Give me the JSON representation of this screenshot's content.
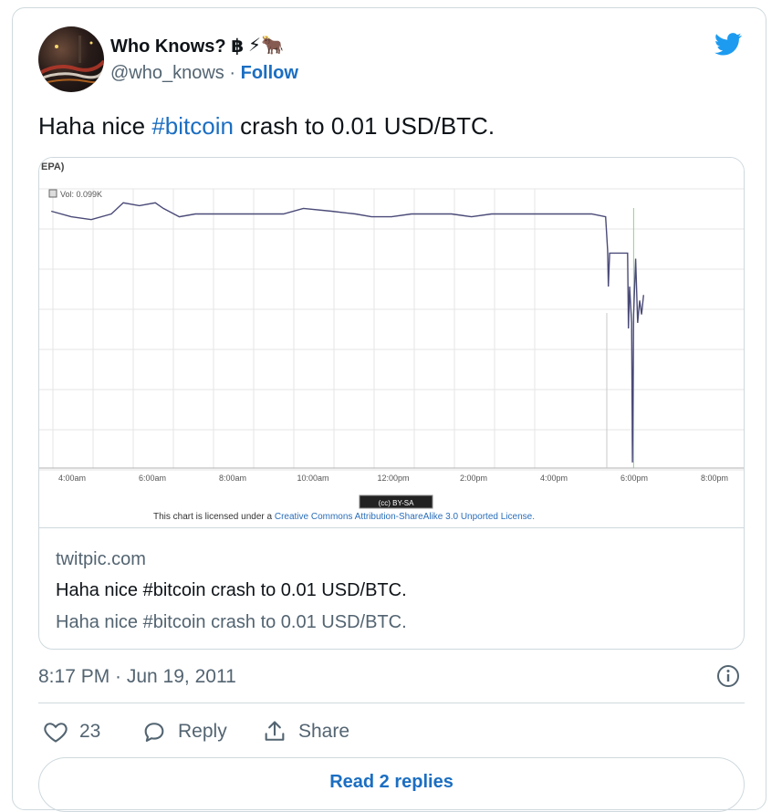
{
  "tweet": {
    "author_name": "Who Knows? ฿",
    "author_emoji": "⚡🐂",
    "handle": "@who_knows",
    "separator": "·",
    "follow_label": "Follow",
    "text_before": "Haha nice ",
    "hashtag": "#bitcoin",
    "text_after": " crash to 0.01 USD/BTC.",
    "timestamp": "8:17 PM · Jun 19, 2011"
  },
  "card": {
    "domain": "twitpic.com",
    "title": "Haha nice #bitcoin crash to 0.01 USD/BTC.",
    "description": "Haha nice #bitcoin crash to 0.01 USD/BTC."
  },
  "chart_data": {
    "type": "line",
    "header": "EPA)",
    "legend": "Vol: 0.099K",
    "x_tick_labels": [
      "4:00am",
      "6:00am",
      "8:00am",
      "10:00am",
      "12:00pm",
      "2:00pm",
      "4:00pm",
      "6:00pm",
      "8:00pm"
    ],
    "license_badge": "(cc) BY-SA",
    "license_prefix": "This chart is licensed under a ",
    "license_link": "Creative Commons Attribution-ShareAlike 3.0 Unported License.",
    "grid": true,
    "series": [
      {
        "color": "#4a4a78",
        "points": [
          [
            3.0,
            0.92
          ],
          [
            3.5,
            0.9
          ],
          [
            4.0,
            0.89
          ],
          [
            4.5,
            0.91
          ],
          [
            4.8,
            0.95
          ],
          [
            5.2,
            0.94
          ],
          [
            5.6,
            0.95
          ],
          [
            5.8,
            0.93
          ],
          [
            6.2,
            0.9
          ],
          [
            6.6,
            0.91
          ],
          [
            7.2,
            0.91
          ],
          [
            8.0,
            0.91
          ],
          [
            8.8,
            0.91
          ],
          [
            9.3,
            0.93
          ],
          [
            10.0,
            0.92
          ],
          [
            10.6,
            0.91
          ],
          [
            11.0,
            0.9
          ],
          [
            11.5,
            0.9
          ],
          [
            12.0,
            0.91
          ],
          [
            12.5,
            0.91
          ],
          [
            13.0,
            0.91
          ],
          [
            13.5,
            0.9
          ],
          [
            14.0,
            0.91
          ],
          [
            14.5,
            0.91
          ],
          [
            15.0,
            0.91
          ],
          [
            15.5,
            0.91
          ],
          [
            16.0,
            0.91
          ],
          [
            16.5,
            0.91
          ],
          [
            16.85,
            0.9
          ],
          [
            16.9,
            0.78
          ],
          [
            16.92,
            0.65
          ],
          [
            16.95,
            0.77
          ],
          [
            17.4,
            0.77
          ],
          [
            17.42,
            0.5
          ],
          [
            17.45,
            0.65
          ],
          [
            17.5,
            0.52
          ],
          [
            17.52,
            0.02
          ],
          [
            17.55,
            0.55
          ],
          [
            17.6,
            0.75
          ],
          [
            17.65,
            0.52
          ],
          [
            17.7,
            0.6
          ],
          [
            17.75,
            0.55
          ],
          [
            17.8,
            0.62
          ]
        ]
      }
    ],
    "xlim": [
      2.7,
      20.3
    ],
    "ylim": [
      0,
      1
    ]
  },
  "actions": {
    "likes_count": "23",
    "reply_label": "Reply",
    "share_label": "Share",
    "read_replies_label": "Read 2 replies"
  },
  "icons": {
    "bird": "twitter-bird-icon",
    "info": "info-icon",
    "like": "heart-icon",
    "reply": "reply-bubble-icon",
    "share": "share-icon"
  },
  "colors": {
    "link": "#1b6ec2",
    "twitter_blue": "#1d9bf0",
    "muted": "#536471"
  }
}
